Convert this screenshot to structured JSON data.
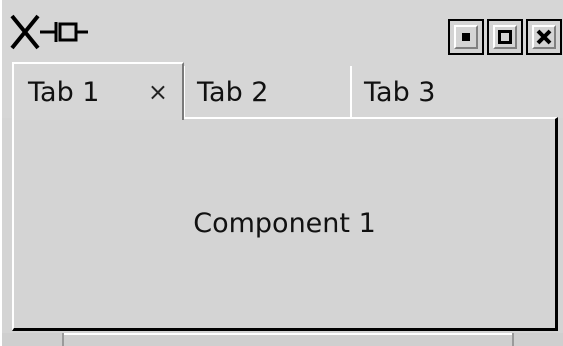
{
  "window": {
    "icon": "x-pin-icon",
    "buttons": [
      {
        "name": "minimize-button",
        "icon": "square-dot-icon"
      },
      {
        "name": "maximize-button",
        "icon": "square-icon"
      },
      {
        "name": "close-button",
        "icon": "x-icon"
      }
    ]
  },
  "tabs": [
    {
      "label": "Tab 1",
      "close": "×",
      "active": true
    },
    {
      "label": "Tab 2",
      "active": false
    },
    {
      "label": "Tab 3",
      "active": false
    }
  ],
  "content": {
    "label": "Component 1"
  }
}
